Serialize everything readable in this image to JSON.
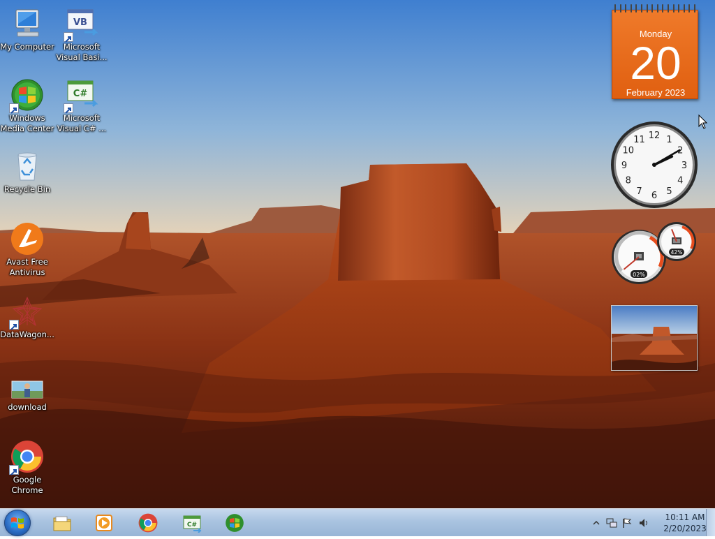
{
  "desktop": {
    "icons": [
      {
        "label": "My Computer",
        "icon": "computer-icon"
      },
      {
        "label": "Microsoft\nVisual Basi...",
        "icon": "visual-basic-icon"
      },
      {
        "label": "Windows\nMedia Center",
        "icon": "media-center-icon"
      },
      {
        "label": "Microsoft\nVisual C# ...",
        "icon": "visual-csharp-icon"
      },
      {
        "label": "Recycle Bin",
        "icon": "recycle-bin-icon"
      },
      {
        "label": "Avast Free\nAntivirus",
        "icon": "avast-icon"
      },
      {
        "label": "DataWagon...",
        "icon": "datawagon-icon"
      },
      {
        "label": "download",
        "icon": "image-thumbnail-icon"
      },
      {
        "label": "Google\nChrome",
        "icon": "chrome-icon"
      }
    ],
    "vb_glyph": "VB",
    "cs_glyph": "C#"
  },
  "gadgets": {
    "calendar": {
      "day_name": "Monday",
      "date": "20",
      "month_year": "February 2023"
    },
    "clock": {
      "hour": 2,
      "minute": 10,
      "numerals": [
        "12",
        "1",
        "2",
        "3",
        "4",
        "5",
        "6",
        "7",
        "8",
        "9",
        "10",
        "11"
      ]
    },
    "meter": {
      "cpu": "02%",
      "memory": "42%",
      "cpu_level": 0.02,
      "memory_level": 0.42
    }
  },
  "taskbar": {
    "start_icon": "windows-logo-icon",
    "pinned": [
      {
        "name": "explorer",
        "icon": "folder-icon"
      },
      {
        "name": "media-player",
        "icon": "media-player-icon"
      },
      {
        "name": "chrome",
        "icon": "chrome-icon"
      },
      {
        "name": "visual-csharp",
        "icon": "visual-csharp-icon",
        "glyph": "C#"
      },
      {
        "name": "media-center",
        "icon": "media-center-icon"
      }
    ],
    "tray": {
      "time": "10:11 AM",
      "date": "2/20/2023"
    }
  },
  "colors": {
    "calendar_orange": "#e8691c",
    "taskbar_blue": "#a9c3e0",
    "sky": "#5f8fd0",
    "rock": "#b4461c"
  }
}
